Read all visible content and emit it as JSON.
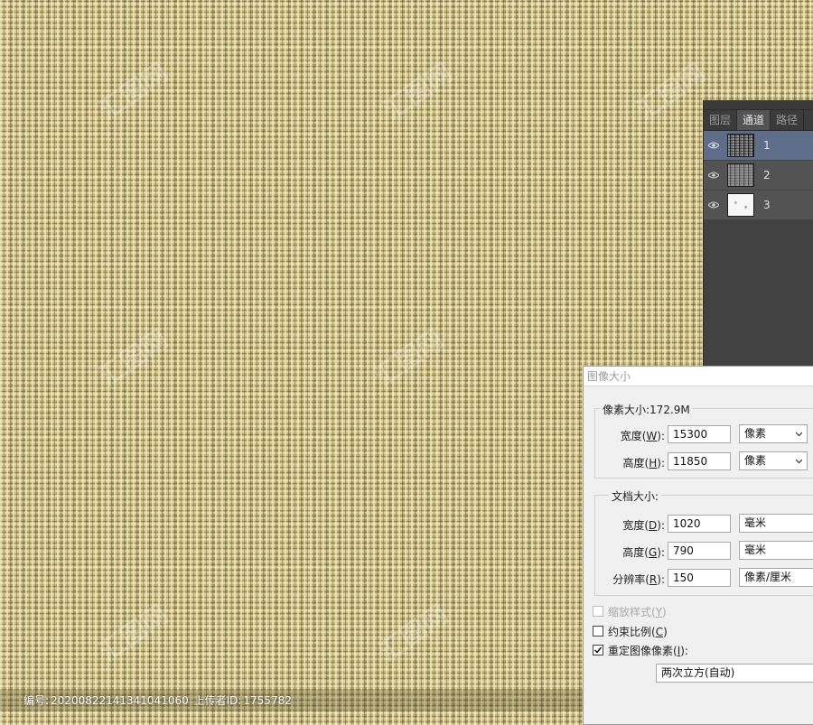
{
  "panel": {
    "tabs": [
      "图层",
      "通道",
      "路径"
    ],
    "active_tab": 1,
    "channels": [
      {
        "name": "1",
        "selected": true
      },
      {
        "name": "2",
        "selected": false
      },
      {
        "name": "3",
        "selected": false
      }
    ]
  },
  "dialog": {
    "title": "图像大小",
    "pixel_dimensions": {
      "legend": "像素大小:172.9M",
      "width_label_prefix": "宽度(",
      "width_key": "W",
      "width_label_suffix": "):",
      "width_value": "15300",
      "width_unit": "像素",
      "height_label_prefix": "高度(",
      "height_key": "H",
      "height_label_suffix": "):",
      "height_value": "11850",
      "height_unit": "像素"
    },
    "document_size": {
      "legend": "文档大小:",
      "width_label_prefix": "宽度(",
      "width_key": "D",
      "width_label_suffix": "):",
      "width_value": "1020",
      "width_unit": "毫米",
      "height_label_prefix": "高度(",
      "height_key": "G",
      "height_label_suffix": "):",
      "height_value": "790",
      "height_unit": "毫米",
      "resolution_label_prefix": "分辨率(",
      "resolution_key": "R",
      "resolution_label_suffix": "):",
      "resolution_value": "150",
      "resolution_unit": "像素/厘米"
    },
    "scale_styles": {
      "label_prefix": "缩放样式(",
      "key": "Y",
      "label_suffix": ")",
      "checked": false,
      "enabled": false
    },
    "constrain": {
      "label_prefix": "约束比例(",
      "key": "C",
      "label_suffix": ")",
      "checked": false,
      "enabled": true
    },
    "resample": {
      "label_prefix": "重定图像像素(",
      "key": "I",
      "label_suffix": "):",
      "checked": true,
      "enabled": true
    },
    "resample_method": "两次立方(自动)"
  },
  "info_bar": {
    "id_label": "编号:",
    "id_value": "20200822141341041060",
    "uploader_label": "上传者ID:",
    "uploader_value": "1755782"
  },
  "watermark": "汇图网",
  "colors": {
    "panel_bg": "#535353",
    "panel_selected": "#5d6d8a",
    "dialog_bg": "#f0f0f0",
    "linen": "#c8b777"
  }
}
